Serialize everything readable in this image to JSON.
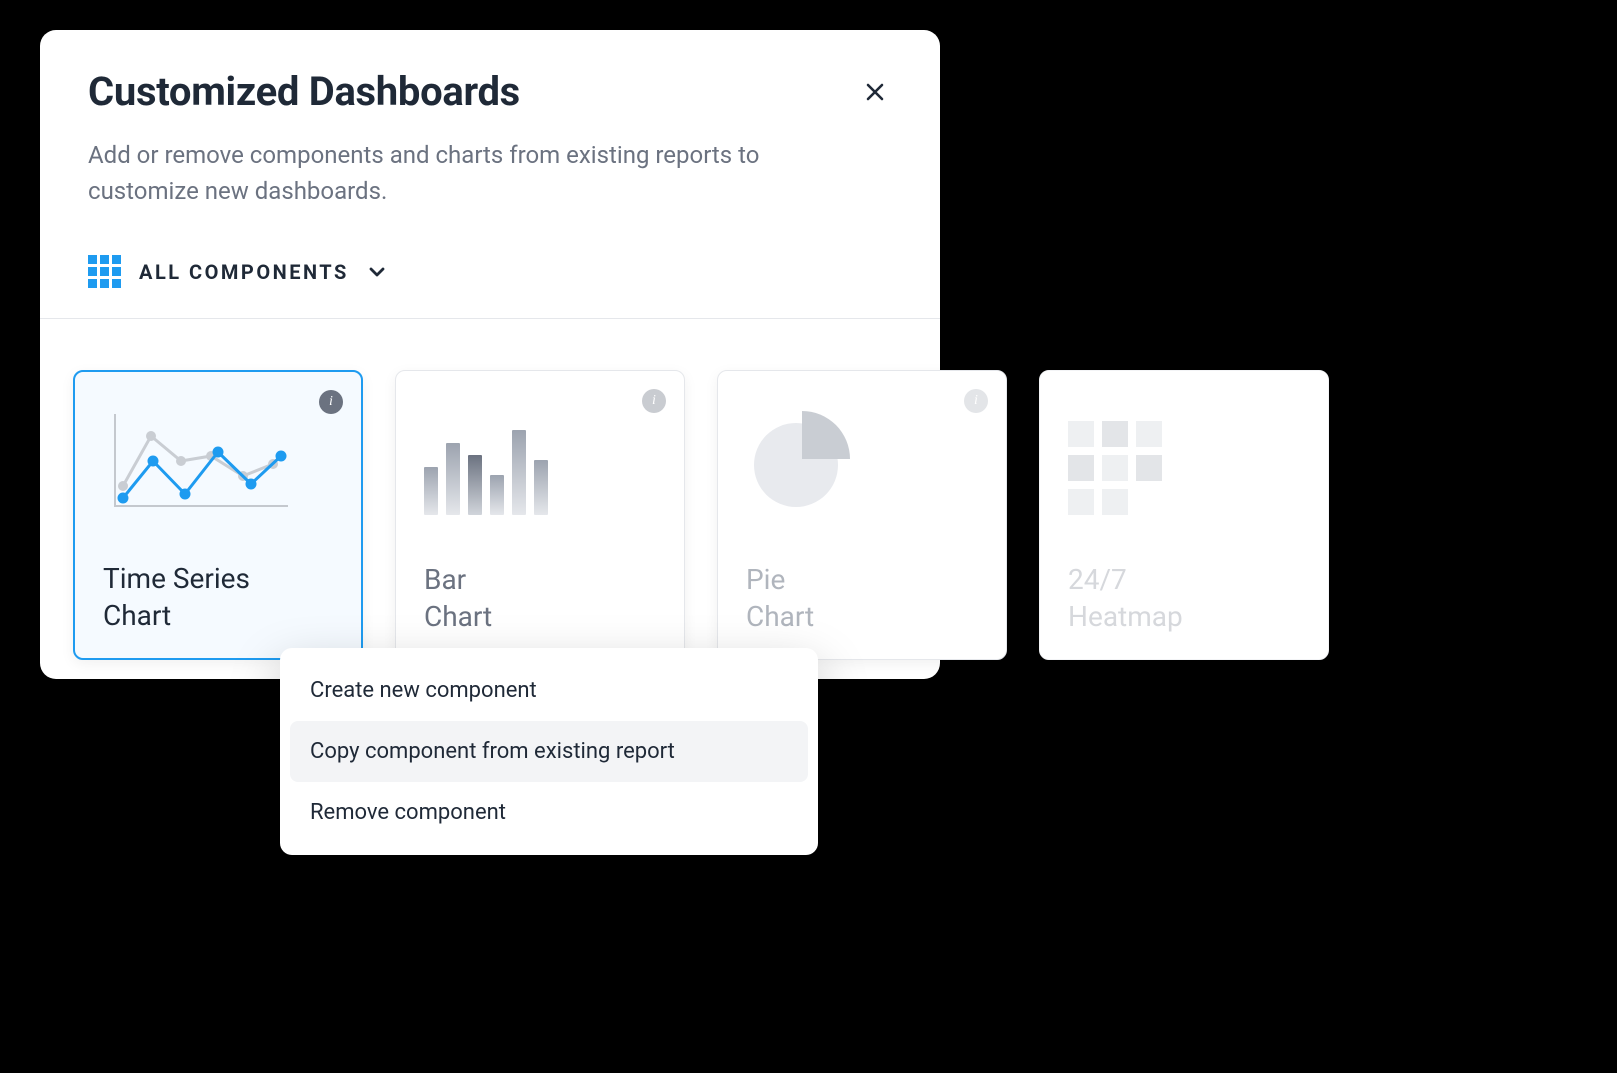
{
  "modal": {
    "title": "Customized Dashboards",
    "subtitle": "Add or remove components and charts from existing reports to customize new dashboards."
  },
  "filter": {
    "label": "ALL COMPONENTS"
  },
  "cards": {
    "time_series": {
      "title_line1": "Time Series",
      "title_line2": "Chart"
    },
    "bar": {
      "title_line1": "Bar",
      "title_line2": "Chart"
    },
    "pie": {
      "title_line1": "Pie",
      "title_line2": "Chart"
    },
    "heatmap": {
      "title_line1": "24/7",
      "title_line2": "Heatmap"
    }
  },
  "menu": {
    "create": "Create new component",
    "copy": "Copy component from existing report",
    "remove": "Remove component"
  },
  "icons": {
    "info_glyph": "i"
  }
}
